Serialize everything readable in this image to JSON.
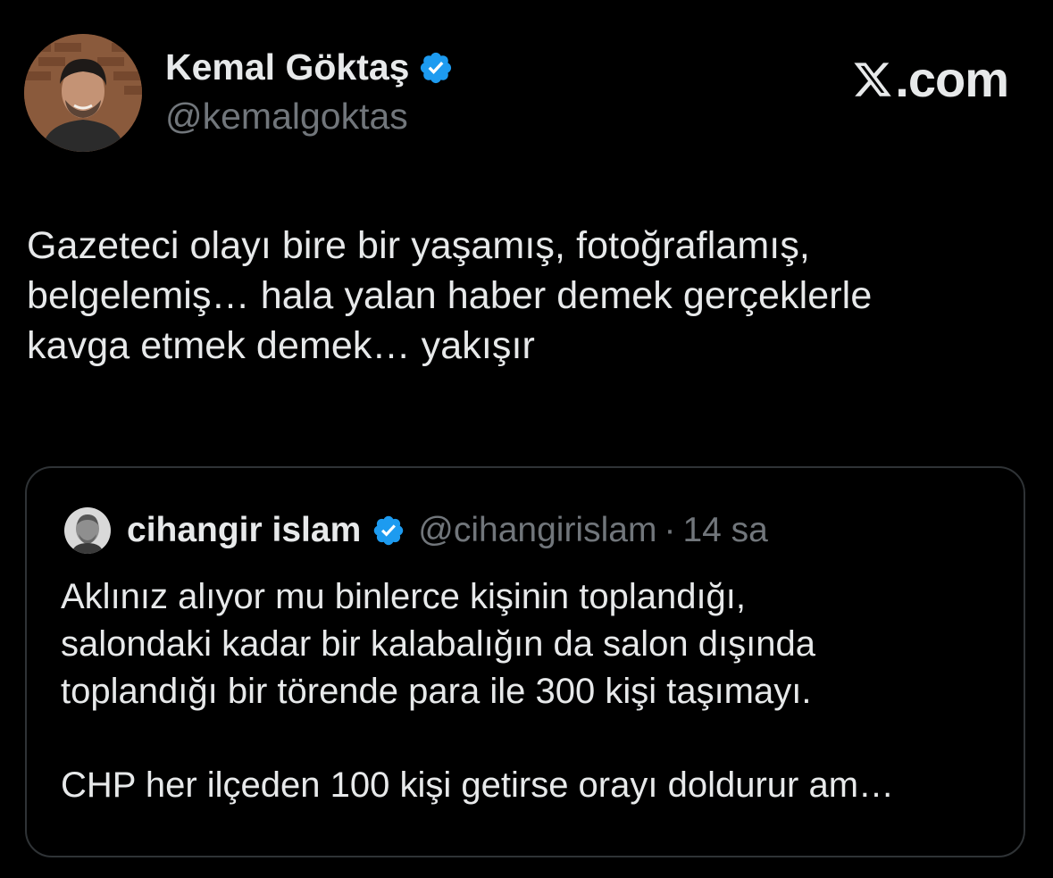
{
  "author": {
    "name": "Kemal Göktaş",
    "handle": "@kemalgoktas",
    "verified_icon": "verified-badge-icon",
    "avatar_icon": "profile-photo"
  },
  "brand": {
    "label": ".com",
    "icon": "x-logo-icon"
  },
  "tweet": {
    "text": "Gazeteci olayı bire bir yaşamış, fotoğraflamış,\nbelgelemiş… hala yalan haber demek gerçeklerle\nkavga etmek demek… yakışır"
  },
  "quote": {
    "name": "cihangir islam",
    "handle": "@cihangirislam",
    "dot": "·",
    "time": "14 sa",
    "text": "Aklınız alıyor mu binlerce kişinin toplandığı,\nsalondaki kadar bir kalabalığın da salon dışında\ntoplandığı bir törende para ile 300 kişi taşımayı.\n\nCHP her ilçeden 100 kişi getirse orayı doldurur am…"
  },
  "colors": {
    "background": "#000000",
    "text": "#e7e9ea",
    "muted": "#71767b",
    "verified": "#1d9bf0",
    "border": "#2f3336"
  }
}
